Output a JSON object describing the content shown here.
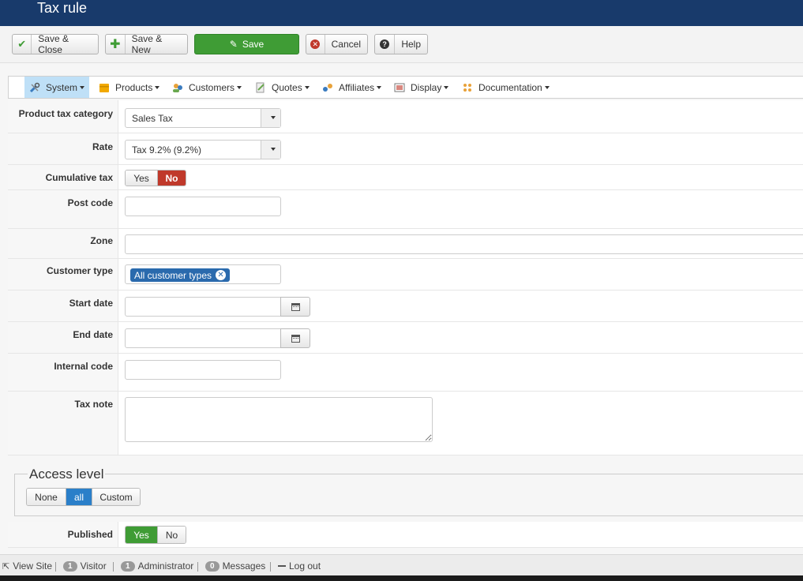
{
  "header": {
    "title": "Tax rule"
  },
  "toolbar": {
    "save_close": "Save & Close",
    "save_new": "Save & New",
    "save": "Save",
    "cancel": "Cancel",
    "help": "Help"
  },
  "menu": {
    "items": [
      {
        "label": "System",
        "icon": "system-tools-icon"
      },
      {
        "label": "Products",
        "icon": "products-box-icon"
      },
      {
        "label": "Customers",
        "icon": "customers-icon"
      },
      {
        "label": "Quotes",
        "icon": "quotes-icon"
      },
      {
        "label": "Affiliates",
        "icon": "affiliates-icon"
      },
      {
        "label": "Display",
        "icon": "display-icon"
      },
      {
        "label": "Documentation",
        "icon": "documentation-icon"
      }
    ]
  },
  "form": {
    "product_tax_category": {
      "label": "Product tax category",
      "value": "Sales Tax"
    },
    "rate": {
      "label": "Rate",
      "value": "Tax 9.2% (9.2%)"
    },
    "cumulative_tax": {
      "label": "Cumulative tax",
      "yes": "Yes",
      "no": "No",
      "selected": "No"
    },
    "post_code": {
      "label": "Post code",
      "value": ""
    },
    "zone": {
      "label": "Zone",
      "value": ""
    },
    "customer_type": {
      "label": "Customer type",
      "tag": "All customer types"
    },
    "start_date": {
      "label": "Start date",
      "value": ""
    },
    "end_date": {
      "label": "End date",
      "value": ""
    },
    "internal_code": {
      "label": "Internal code",
      "value": ""
    },
    "tax_note": {
      "label": "Tax note",
      "value": ""
    }
  },
  "access_level": {
    "legend": "Access level",
    "options": [
      "None",
      "all",
      "Custom"
    ],
    "selected": "all"
  },
  "published": {
    "label": "Published",
    "yes": "Yes",
    "no": "No",
    "selected": "Yes"
  },
  "statusbar": {
    "view_site": "View Site",
    "visitor_count": "1",
    "visitor": "Visitor",
    "admin_count": "1",
    "administrator": "Administrator",
    "messages_count": "0",
    "messages": "Messages",
    "logout": "Log out"
  },
  "colors": {
    "header_bg": "#183a6b",
    "save_green": "#3f9c35",
    "no_red": "#c0392b",
    "selected_blue": "#2a7fc9",
    "menu_active": "#bfe0f7"
  }
}
